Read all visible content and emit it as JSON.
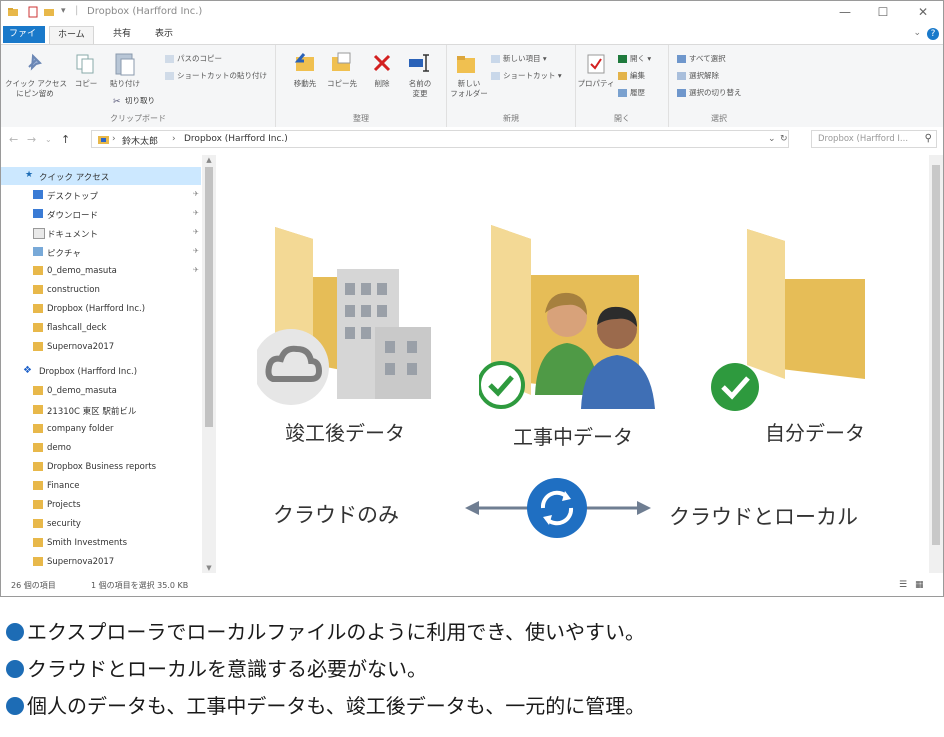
{
  "window": {
    "title": "Dropbox (Harfford Inc.)",
    "controls": {
      "minimize": "—",
      "maximize": "☐",
      "close": "✕"
    }
  },
  "ribbon_tabs": [
    "ファイル",
    "ホーム",
    "共有",
    "表示"
  ],
  "ribbon": {
    "clipboard": {
      "pin": "クイック アクセス\nにピン留め",
      "copy": "コピー",
      "paste": "貼り付け",
      "copy_path": "パスのコピー",
      "paste_shortcut": "ショートカットの貼り付け",
      "cut": "切り取り",
      "label": "クリップボード"
    },
    "organize": {
      "move_to": "移動先",
      "copy_to": "コピー先",
      "delete": "削除",
      "rename": "名前の\n変更",
      "label": "整理"
    },
    "new": {
      "new_item": "新しい項目",
      "shortcut": "ショートカット",
      "new_folder": "新しい\nフォルダー",
      "label": "新規"
    },
    "open": {
      "properties": "プロパティ",
      "open": "開く",
      "edit": "編集",
      "history": "履歴",
      "label": "開く"
    },
    "select": {
      "select_all": "すべて選択",
      "select_none": "選択解除",
      "invert": "選択の切り替え",
      "label": "選択"
    }
  },
  "address": {
    "crumbs": [
      "鈴木太郎",
      "Dropbox (Harfford Inc.)"
    ],
    "search_placeholder": "Dropbox (Harfford I..."
  },
  "nav": {
    "items": [
      {
        "label": "クイック アクセス",
        "pinned": false
      },
      {
        "label": "デスクトップ",
        "pinned": true
      },
      {
        "label": "ダウンロード",
        "pinned": true
      },
      {
        "label": "ドキュメント",
        "pinned": true
      },
      {
        "label": "ピクチャ",
        "pinned": true
      },
      {
        "label": "0_demo_masuta",
        "pinned": true
      },
      {
        "label": "construction",
        "pinned": false
      },
      {
        "label": "Dropbox (Harfford Inc.)",
        "pinned": false
      },
      {
        "label": "flashcall_deck",
        "pinned": false
      },
      {
        "label": "Supernova2017",
        "pinned": false
      },
      {
        "label": "Dropbox (Harfford Inc.)",
        "pinned": false
      },
      {
        "label": "0_demo_masuta",
        "pinned": false
      },
      {
        "label": "21310C 東区 駅前ビル",
        "pinned": false
      },
      {
        "label": "company folder",
        "pinned": false
      },
      {
        "label": "demo",
        "pinned": false
      },
      {
        "label": "Dropbox Business reports",
        "pinned": false
      },
      {
        "label": "Finance",
        "pinned": false
      },
      {
        "label": "Projects",
        "pinned": false
      },
      {
        "label": "security",
        "pinned": false
      },
      {
        "label": "Smith Investments",
        "pinned": false
      },
      {
        "label": "Supernova2017",
        "pinned": false
      }
    ]
  },
  "folders": [
    {
      "label": "竣工後データ",
      "status": "cloud-only"
    },
    {
      "label": "工事中データ",
      "status": "synced"
    },
    {
      "label": "自分データ",
      "status": "local"
    }
  ],
  "sync": {
    "left": "クラウドのみ",
    "right": "クラウドとローカル"
  },
  "status_bar": {
    "count": "26 個の項目",
    "selected": "1 個の項目を選択  35.0 KB"
  },
  "bullets": [
    "エクスプローラでローカルファイルのように利用でき、使いやすい。",
    "クラウドとローカルを意識する必要がない。",
    "個人のデータも、工事中データも、竣工後データも、一元的に管理。"
  ],
  "colors": {
    "accent": "#1979ca",
    "bullet": "#1d6cb5",
    "folder": "#f0cf7e",
    "check": "#2e9a3e"
  }
}
